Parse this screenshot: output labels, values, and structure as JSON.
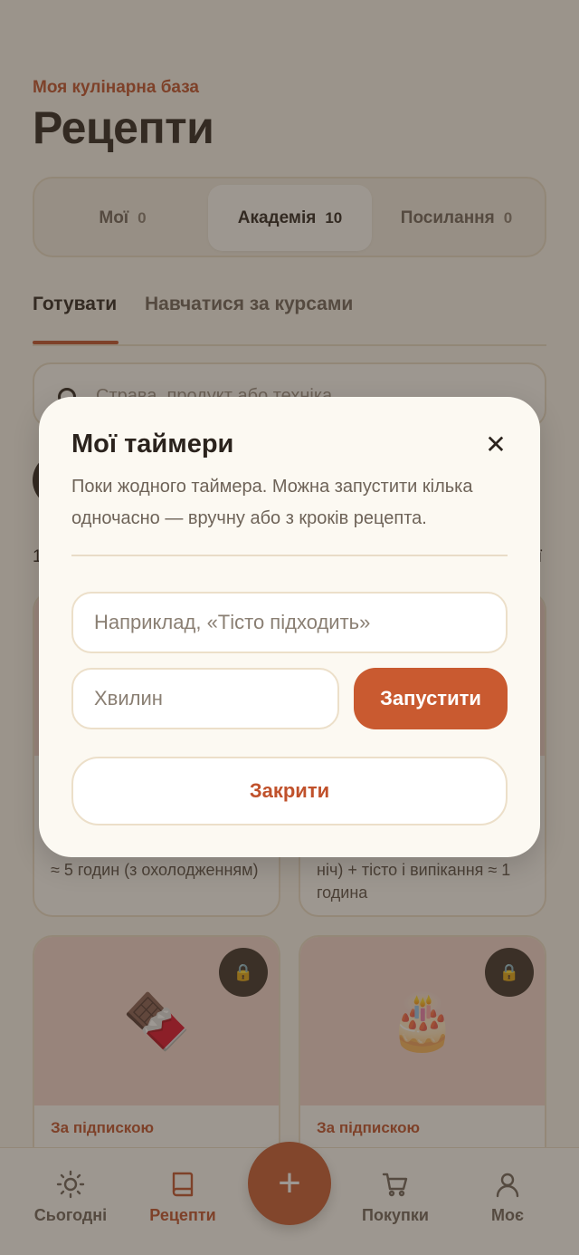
{
  "header": {
    "eyebrow": "Моя кулінарна база",
    "title": "Рецепти"
  },
  "segments": [
    {
      "label": "Мої",
      "count": "0",
      "active": false
    },
    {
      "label": "Академія",
      "count": "10",
      "active": true
    },
    {
      "label": "Посилання",
      "count": "0",
      "active": false
    }
  ],
  "tabs": [
    {
      "label": "Готувати",
      "active": true
    },
    {
      "label": "Навчатися за курсами",
      "active": false
    }
  ],
  "search": {
    "placeholder": "Страва, продукт або техніка"
  },
  "list_meta": {
    "left": "1",
    "right": "ї"
  },
  "cards": [
    {
      "time": "≈ 5 годин (з охолодженням)"
    },
    {
      "time": "ніч) + тісто і випікання ≈ 1 година"
    },
    {
      "emoji": "🍫",
      "badge": "За підпискою",
      "lock": "🔒"
    },
    {
      "emoji": "🎂",
      "badge": "За підпискою",
      "lock": "🔒"
    }
  ],
  "bottom_nav": [
    {
      "label": "Сьогодні",
      "icon": "sun-icon",
      "active": false
    },
    {
      "label": "Рецепти",
      "icon": "book-icon",
      "active": true
    },
    {
      "label": "Покупки",
      "icon": "cart-icon",
      "active": false
    },
    {
      "label": "Моє",
      "icon": "user-icon",
      "active": false
    }
  ],
  "fab": {
    "label": "+"
  },
  "modal": {
    "title": "Мої таймери",
    "close_glyph": "✕",
    "description": "Поки жодного таймера. Можна запустити кілька одночасно — вручну або з кроків рецепта.",
    "name_placeholder": "Наприклад, «Тісто підходить»",
    "minutes_placeholder": "Хвилин",
    "start_label": "Запустити",
    "close_label": "Закрити"
  },
  "colors": {
    "accent": "#c95a30",
    "accent_text": "#c0512b",
    "background": "#faf6ef",
    "text": "#2b231d"
  }
}
